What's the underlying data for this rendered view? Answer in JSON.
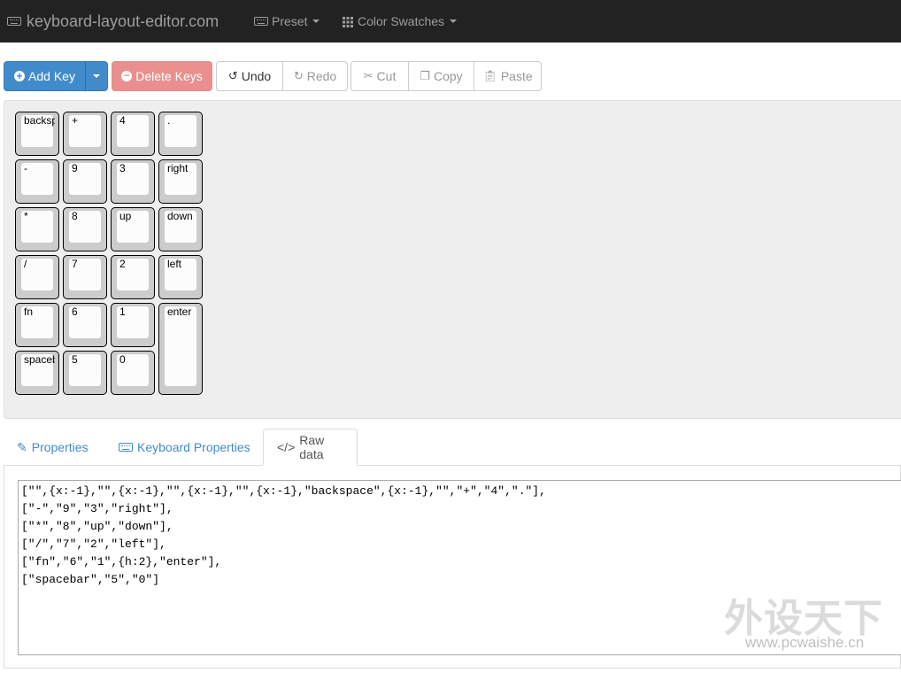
{
  "navbar": {
    "brand": "keyboard-layout-editor.com",
    "preset": "Preset",
    "color_swatches": "Color Swatches"
  },
  "toolbar": {
    "add_key": "Add Key",
    "delete_keys": "Delete Keys",
    "undo": "Undo",
    "redo": "Redo",
    "cut": "Cut",
    "copy": "Copy",
    "paste": "Paste"
  },
  "keys": [
    {
      "label": "backspace"
    },
    {
      "label": "+"
    },
    {
      "label": "4"
    },
    {
      "label": "."
    },
    {
      "label": "-"
    },
    {
      "label": "9"
    },
    {
      "label": "3"
    },
    {
      "label": "right"
    },
    {
      "label": "*"
    },
    {
      "label": "8"
    },
    {
      "label": "up"
    },
    {
      "label": "down"
    },
    {
      "label": "/"
    },
    {
      "label": "7"
    },
    {
      "label": "2"
    },
    {
      "label": "left"
    },
    {
      "label": "fn"
    },
    {
      "label": "6"
    },
    {
      "label": "1"
    },
    {
      "label": "enter"
    },
    {
      "label": "spacebar"
    },
    {
      "label": "5"
    },
    {
      "label": "0"
    }
  ],
  "tabs": {
    "properties": "Properties",
    "keyboard_properties": "Keyboard Properties",
    "raw_data": "Raw data"
  },
  "raw_data": "[\"\",{x:-1},\"\",{x:-1},\"\",{x:-1},\"\",{x:-1},\"backspace\",{x:-1},\"\",\"+\",\"4\",\".\"],\n[\"-\",\"9\",\"3\",\"right\"],\n[\"*\",\"8\",\"up\",\"down\"],\n[\"/\",\"7\",\"2\",\"left\"],\n[\"fn\",\"6\",\"1\",{h:2},\"enter\"],\n[\"spacebar\",\"5\",\"0\"]",
  "watermark": {
    "chinese": "外设天下",
    "url": "www.pcwaishe.cn"
  }
}
